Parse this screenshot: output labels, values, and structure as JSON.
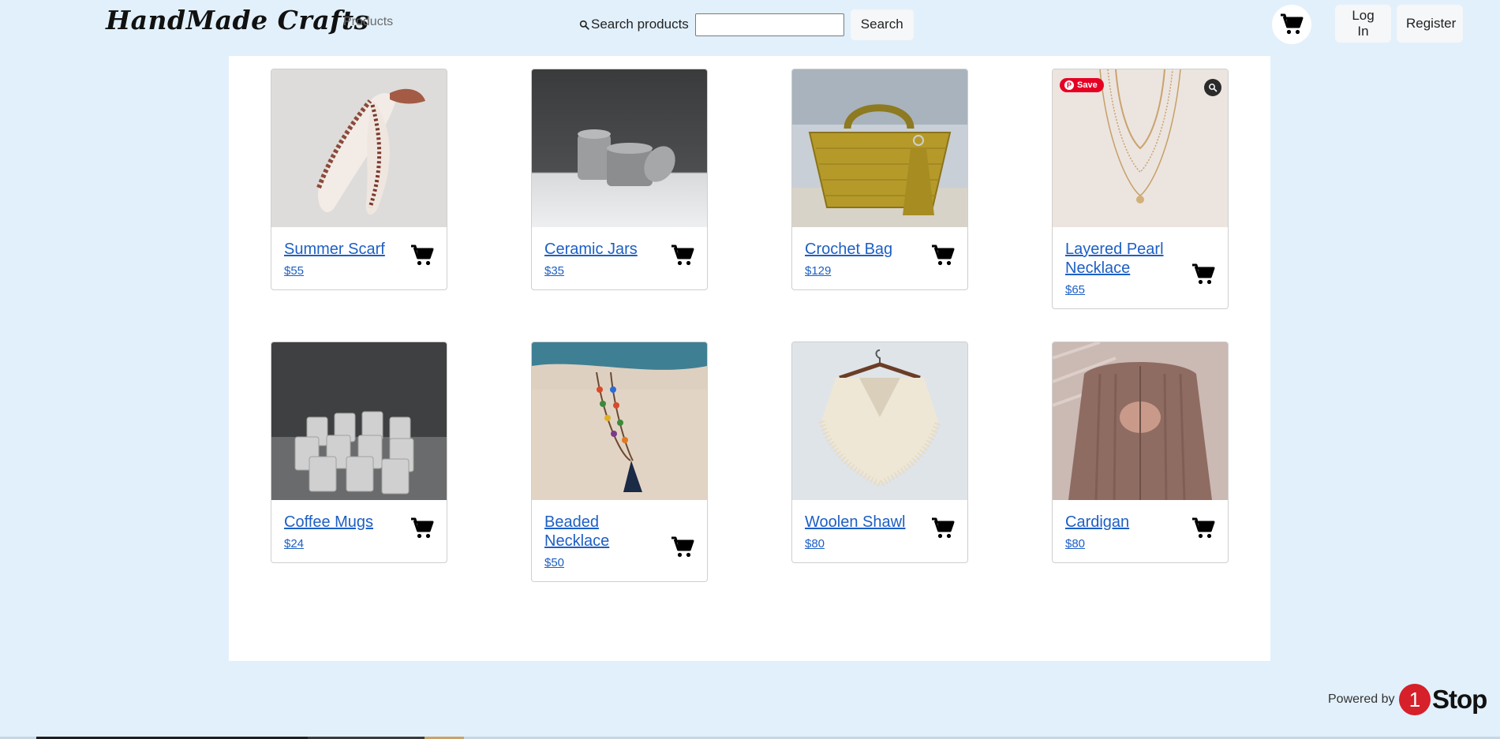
{
  "header": {
    "brand": "HandMade Crafts",
    "nav_products": "Products",
    "search_label": "Search products",
    "search_value": "",
    "search_button": "Search",
    "login": "Log In",
    "register": "Register"
  },
  "products": [
    {
      "name": "Summer Scarf",
      "price": "$55"
    },
    {
      "name": "Ceramic Jars",
      "price": "$35"
    },
    {
      "name": "Crochet Bag",
      "price": "$129"
    },
    {
      "name": "Layered Pearl Necklace",
      "price": "$65"
    },
    {
      "name": "Coffee Mugs",
      "price": "$24"
    },
    {
      "name": "Beaded Necklace",
      "price": "$50"
    },
    {
      "name": "Woolen Shawl",
      "price": "$80"
    },
    {
      "name": "Cardigan",
      "price": "$80"
    }
  ],
  "overlay": {
    "pin_save": "Save"
  },
  "footer": {
    "powered_by": "Powered by",
    "logo_number": "1",
    "logo_word": "Stop"
  },
  "icons": {
    "cart": "shopping-cart-icon",
    "search": "magnifier-icon",
    "lens": "visual-search-icon"
  },
  "colors": {
    "background": "#e2f0fb",
    "link": "#1d5fc4",
    "brand_red": "#d6202a",
    "pinterest": "#e60023"
  }
}
